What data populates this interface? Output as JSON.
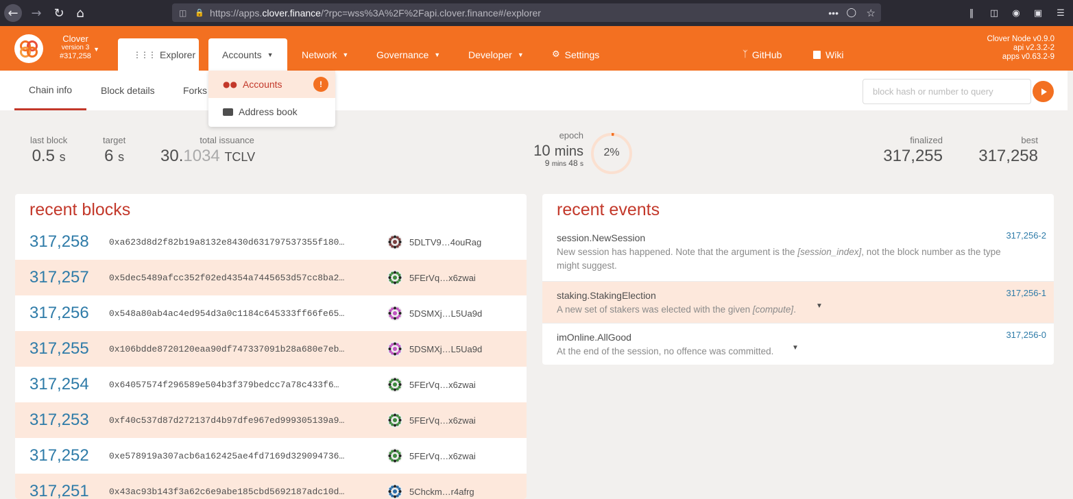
{
  "browser": {
    "url_prefix": "https://apps.",
    "url_domain": "clover.finance",
    "url_rest": "/?rpc=wss%3A%2F%2Fapi.clover.finance#/explorer"
  },
  "chain": {
    "name": "Clover",
    "version": "version 3",
    "block": "#317,258"
  },
  "nav": {
    "explorer": "Explorer",
    "accounts": "Accounts",
    "network": "Network",
    "governance": "Governance",
    "developer": "Developer",
    "settings": "Settings",
    "github": "GitHub",
    "wiki": "Wiki"
  },
  "node": {
    "line1": "Clover Node v0.9.0",
    "line2": "api v2.3.2-2",
    "line3": "apps v0.63.2-9"
  },
  "accounts_menu": {
    "accounts": "Accounts",
    "badge": "!",
    "address_book": "Address book"
  },
  "subnav": {
    "chain_info": "Chain info",
    "block_details": "Block details",
    "forks": "Forks",
    "search_placeholder": "block hash or number to query"
  },
  "stats": {
    "last_block_label": "last block",
    "last_block_value": "0.5",
    "last_block_unit": "s",
    "target_label": "target",
    "target_value": "6",
    "target_unit": "s",
    "issuance_label": "total issuance",
    "issuance_int": "30.",
    "issuance_dec": "1034",
    "issuance_unit": "TCLV",
    "epoch_label": "epoch",
    "epoch_value": "10",
    "epoch_unit": "mins",
    "epoch_remaining_mins": "9",
    "epoch_mins_unit": "mins",
    "epoch_remaining_secs": "48",
    "epoch_secs_unit": "s",
    "epoch_percent_label": "2%",
    "epoch_progress": 0.02,
    "finalized_label": "finalized",
    "finalized_value": "317,255",
    "best_label": "best",
    "best_value": "317,258"
  },
  "recent_blocks": {
    "title": "recent blocks",
    "rows": [
      {
        "number": "317,258",
        "hash": "0xa623d8d2f82b19a8132e8430d631797537355f180…",
        "author": "5DLTV9…4ouRag",
        "color": "#7a3e3e"
      },
      {
        "number": "317,257",
        "hash": "0x5dec5489afcc352f02ed4354a7445653d57cc8ba2…",
        "author": "5FErVq…x6zwai",
        "color": "#3f8a3f"
      },
      {
        "number": "317,256",
        "hash": "0x548a80ab4ac4ed954d3a0c1184c645333ff66fe65…",
        "author": "5DSMXj…L5Ua9d",
        "color": "#c054c0"
      },
      {
        "number": "317,255",
        "hash": "0x106bdde8720120eaa90df747337091b28a680e7eb…",
        "author": "5DSMXj…L5Ua9d",
        "color": "#c054c0"
      },
      {
        "number": "317,254",
        "hash": "0x64057574f296589e504b3f379bedcc7a78c433f6…",
        "author": "5FErVq…x6zwai",
        "color": "#3f8a3f"
      },
      {
        "number": "317,253",
        "hash": "0xf40c537d87d272137d4b97dfe967ed999305139a9…",
        "author": "5FErVq…x6zwai",
        "color": "#3f8a3f"
      },
      {
        "number": "317,252",
        "hash": "0xe578919a307acb6a162425ae4fd7169d329094736…",
        "author": "5FErVq…x6zwai",
        "color": "#3f8a3f"
      },
      {
        "number": "317,251",
        "hash": "0x43ac93b143f3a62c6e9abe185cbd5692187adc10d…",
        "author": "5Chckm…r4afrg",
        "color": "#2e6fa8"
      }
    ]
  },
  "recent_events": {
    "title": "recent events",
    "rows": [
      {
        "name": "session.NewSession",
        "desc_a": "New session has happened. Note that the argument is the ",
        "desc_em": "[session_index]",
        "desc_b": ", not the block number as the type might suggest.",
        "ref": "317,256-2"
      },
      {
        "name": "staking.StakingElection",
        "desc_a": "A new set of stakers was elected with the given ",
        "desc_em": "[compute]",
        "desc_b": ".",
        "ref": "317,256-1"
      },
      {
        "name": "imOnline.AllGood",
        "desc_a": "At the end of the session, no offence was committed.",
        "desc_em": "",
        "desc_b": "",
        "ref": "317,256-0"
      }
    ]
  },
  "colors": {
    "brand_orange": "#f37021",
    "title_red": "#c3382a",
    "link_blue": "#2e7ba8",
    "row_highlight": "#fde8dc"
  }
}
